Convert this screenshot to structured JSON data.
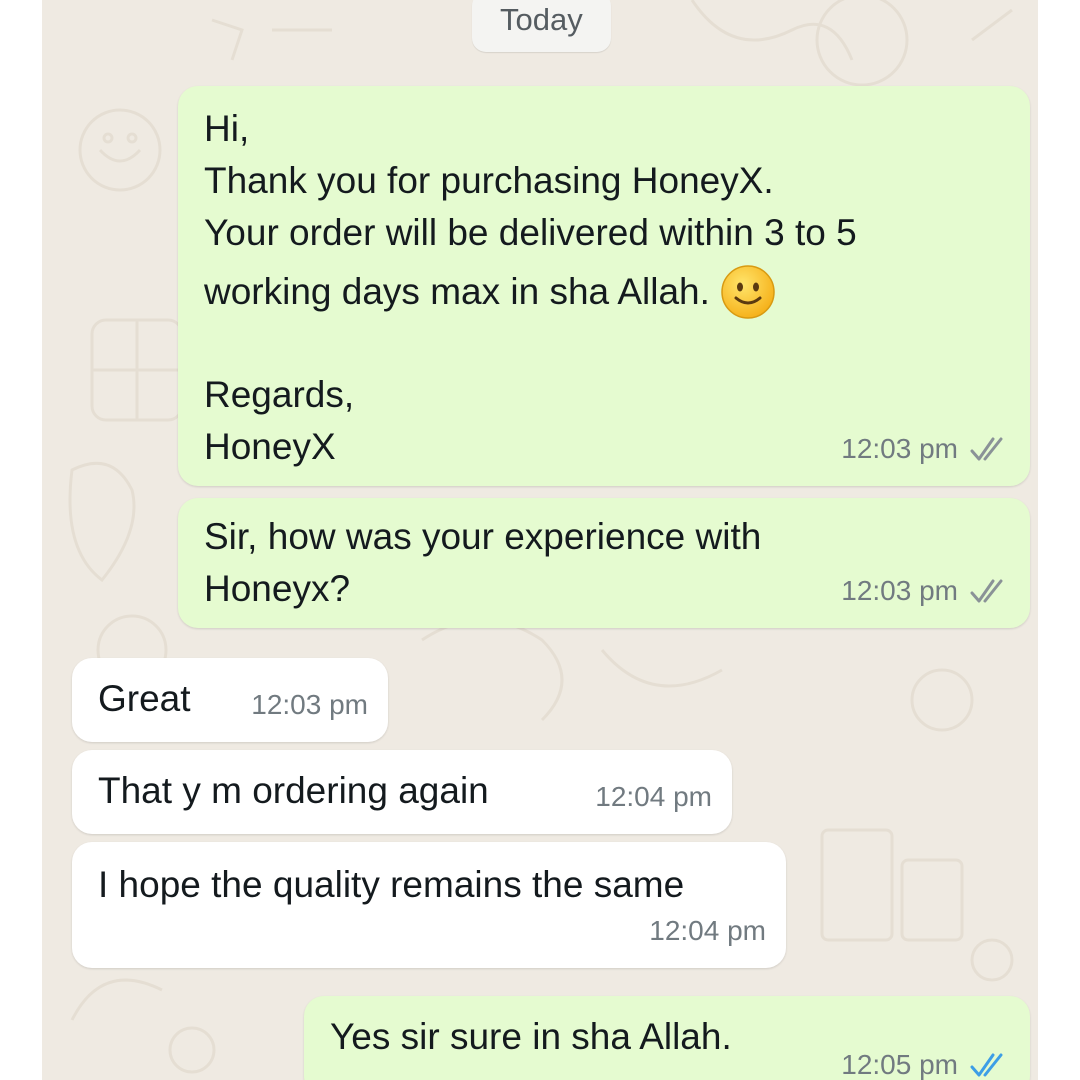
{
  "chat": {
    "date_chip": "Today",
    "messages": [
      {
        "direction": "outgoing",
        "lines": [
          "Hi,",
          "Thank you for purchasing HoneyX.",
          "Your order will be delivered within 3 to 5",
          "working days max in sha Allah."
        ],
        "emoji": "slightly-smiling-face",
        "sign_off": [
          "Regards,",
          "HoneyX"
        ],
        "time": "12:03 pm",
        "status": "read-grey"
      },
      {
        "direction": "outgoing",
        "lines": [
          "Sir, how was your experience with",
          "Honeyx?"
        ],
        "time": "12:03 pm",
        "status": "read-grey"
      },
      {
        "direction": "incoming",
        "text": "Great",
        "time": "12:03 pm"
      },
      {
        "direction": "incoming",
        "text": "That y m ordering again",
        "time": "12:04 pm"
      },
      {
        "direction": "incoming",
        "text": "I hope the quality remains the same",
        "time": "12:04 pm"
      },
      {
        "direction": "outgoing",
        "text": "Yes sir sure in sha Allah.",
        "time": "12:05 pm",
        "status": "read-blue"
      }
    ]
  },
  "colors": {
    "outgoing_bubble": "#e5fbd0",
    "incoming_bubble": "#ffffff",
    "chat_background": "#efeae2",
    "tick_grey": "#8a9297",
    "tick_blue": "#3d9ee6"
  }
}
